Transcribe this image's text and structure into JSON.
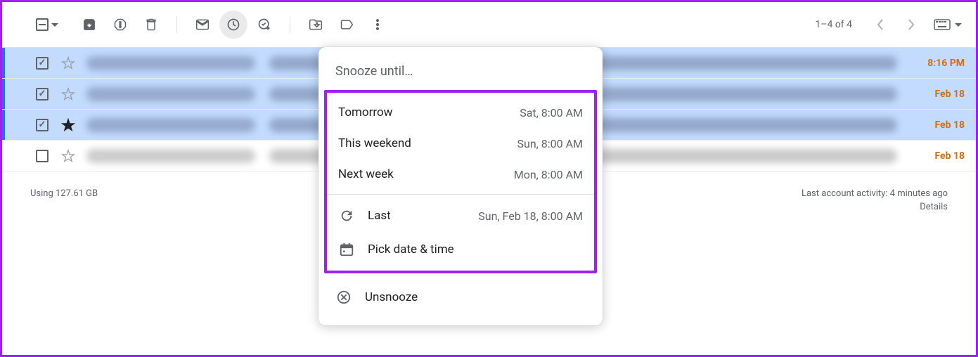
{
  "toolbar": {
    "pagination": "1–4 of 4"
  },
  "emails": [
    {
      "selected": true,
      "starred": false,
      "time": "8:16 PM"
    },
    {
      "selected": true,
      "starred": false,
      "time": "Feb 18"
    },
    {
      "selected": true,
      "starred": true,
      "time": "Feb 18"
    },
    {
      "selected": false,
      "starred": false,
      "time": "Feb 18"
    }
  ],
  "footer": {
    "storage": "Using 127.61 GB",
    "activity": "Last account activity: 4 minutes ago",
    "details": "Details"
  },
  "snooze": {
    "title": "Snooze until…",
    "options": [
      {
        "label": "Tomorrow",
        "time": "Sat, 8:00 AM"
      },
      {
        "label": "This weekend",
        "time": "Sun, 8:00 AM"
      },
      {
        "label": "Next week",
        "time": "Mon, 8:00 AM"
      }
    ],
    "last": {
      "label": "Last",
      "time": "Sun, Feb 18, 8:00 AM"
    },
    "pick": "Pick date & time",
    "unsnooze": "Unsnooze"
  }
}
